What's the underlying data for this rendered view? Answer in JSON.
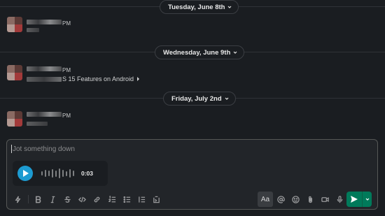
{
  "dates": [
    {
      "label": "Tuesday, June 8th"
    },
    {
      "label": "Wednesday, June 9th"
    },
    {
      "label": "Friday, July 2nd"
    }
  ],
  "messages": [
    {
      "time_tail": "PM",
      "text": ""
    },
    {
      "time_tail": "PM",
      "text": "S 15 Features on Android"
    },
    {
      "time_tail": "PM",
      "text": ""
    }
  ],
  "composer": {
    "placeholder": "Jot something down",
    "voice_clip": {
      "duration": "0:03"
    },
    "toolbar": {
      "font_toggle_label": "Aa"
    }
  },
  "colors": {
    "background": "#1a1d21",
    "send_button": "#007a5a",
    "play_button": "#1d9bd1"
  }
}
